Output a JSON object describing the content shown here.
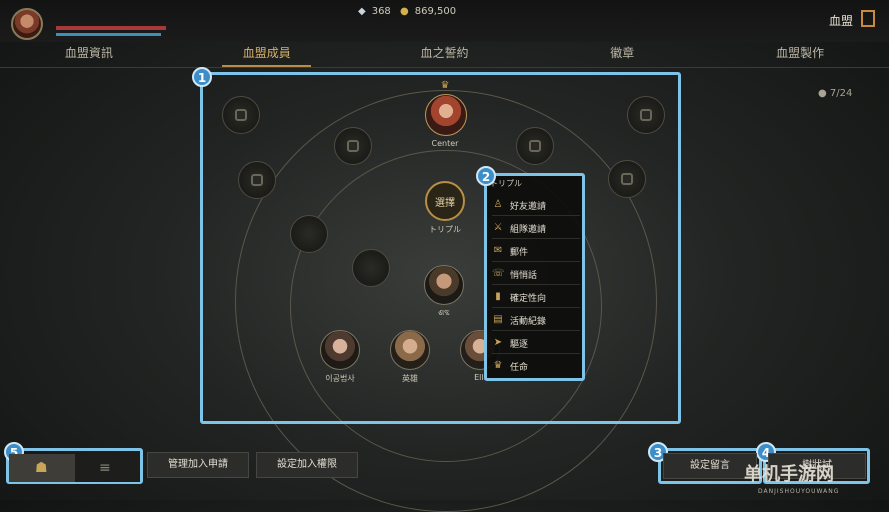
{
  "header": {
    "gems": "368",
    "gold": "869,500",
    "clan_title": "血盟"
  },
  "tabs": [
    "血盟資訊",
    "血盟成員",
    "血之誓約",
    "徽章",
    "血盟製作"
  ],
  "active_tab": 1,
  "member_count": "7/24",
  "tree": {
    "center_label": "Center",
    "select_button": "選擇",
    "select_sublabel": "トリプル",
    "member_mid": "ଶବ୍ଦ",
    "bottom_members": [
      "이공법사",
      "英雄",
      "Elli"
    ]
  },
  "context_menu": {
    "title": "トリプル",
    "items": [
      {
        "label": "好友邀請",
        "icon": "person-add-icon"
      },
      {
        "label": "組隊邀請",
        "icon": "party-icon"
      },
      {
        "label": "郵件",
        "icon": "mail-icon"
      },
      {
        "label": "悄悄話",
        "icon": "whisper-icon"
      },
      {
        "label": "確定性向",
        "icon": "chart-icon"
      },
      {
        "label": "活動紀錄",
        "icon": "log-icon"
      },
      {
        "label": "驅逐",
        "icon": "kick-icon"
      },
      {
        "label": "任命",
        "icon": "crown-icon"
      }
    ]
  },
  "badges": [
    "1",
    "2",
    "3",
    "4",
    "5"
  ],
  "bottom": {
    "manage_requests": "管理加入申請",
    "set_permissions": "設定加入權限",
    "set_notice": "設定留言",
    "tree_button": "樹狀試",
    "watermark": "单机手游网",
    "watermark_sub": "DANJISHOUYOUWANG"
  }
}
